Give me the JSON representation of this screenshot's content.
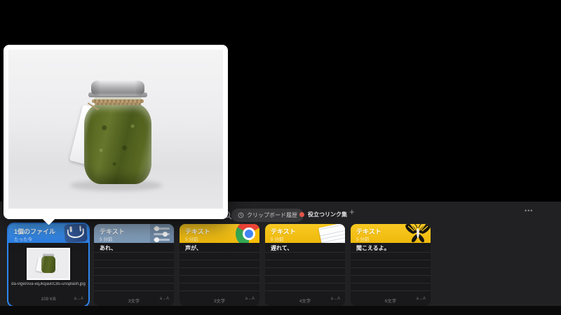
{
  "toolbar": {
    "clipboard_tab_label": "クリップボード履歴",
    "links_tab_label": "役立つリンク集",
    "add_button": "+",
    "more_button": "•••"
  },
  "ui": {
    "footer_glyph": "a→A",
    "accent_blue": "#2e86f0",
    "header_blue": "#3793f5",
    "header_slate": "#8aa6c3",
    "header_yellow": "#f6c31d",
    "links_dot_color": "#e4554a",
    "panel_background": "#212123"
  },
  "cards": [
    {
      "type": "file",
      "title": "1個のファイル",
      "subtitle": "たった今",
      "app_icon": "finder-icon",
      "filename": "da-vigerova-eqJkqau0C8s-unsplash.jpg",
      "filesize": "109 KB",
      "selected": true
    },
    {
      "type": "text",
      "title": "テキスト",
      "subtitle": "5 分前",
      "app_icon": "settings-sliders-icon",
      "body": "あれ、",
      "char_count": "3文字"
    },
    {
      "type": "text",
      "title": "テキスト",
      "subtitle": "5 分前",
      "app_icon": "chrome-icon",
      "body": "声が、",
      "char_count": "3文字"
    },
    {
      "type": "text",
      "title": "テキスト",
      "subtitle": "5 分前",
      "app_icon": "notepad-icon",
      "body": "遅れて、",
      "char_count": "4文字"
    },
    {
      "type": "text",
      "title": "テキスト",
      "subtitle": "5 分前",
      "app_icon": "butterfly-icon",
      "body": "聞こえるよ。",
      "char_count": "6文字"
    }
  ],
  "preview": {
    "content": "pesto-jar-photo-with-blank-tag",
    "points_to_card": "1個のファイル"
  }
}
